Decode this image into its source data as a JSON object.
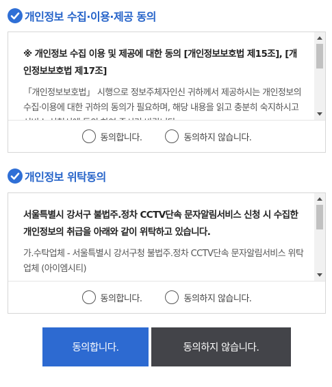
{
  "section1": {
    "title": "개인정보 수집·이용·제공 동의",
    "heading": "※ 개인정보 수집 이용 및 제공에 대한 동의 [개인정보보호법 제15조], [개인정보보호법 제17조]",
    "body": "「개인정보보호법」 시행으로 정보주체자인신 귀하께서 제공하시는 개인정보의 수집·이용에 대한 귀하의 동의가 필요하며, 해당 내용을 읽고 충분히 숙지하시고 서비스 신청서에 동의 하여 주시기 바랍니다.",
    "agree_label": "동의합니다.",
    "disagree_label": "동의하지 않습니다."
  },
  "section2": {
    "title": "개인정보 위탁동의",
    "heading": "서울특별시 강서구 불법주.정차 CCTV단속 문자알림서비스 신청 시 수집한 개인정보의 취급을 아래와 같이 위탁하고 있습니다.",
    "body": "가.수탁업체 - 서울특별시 강서구청 불법주.정차 CCTV단속 문자알림서비스 위탁업체 (아이엠시티)",
    "agree_label": "동의합니다.",
    "disagree_label": "동의하지 않습니다."
  },
  "buttons": {
    "agree": "동의합니다.",
    "disagree": "동의하지 않습니다."
  },
  "colors": {
    "accent": "#2d6ad1",
    "dark_button": "#434449",
    "title_blue": "#2563c9"
  }
}
